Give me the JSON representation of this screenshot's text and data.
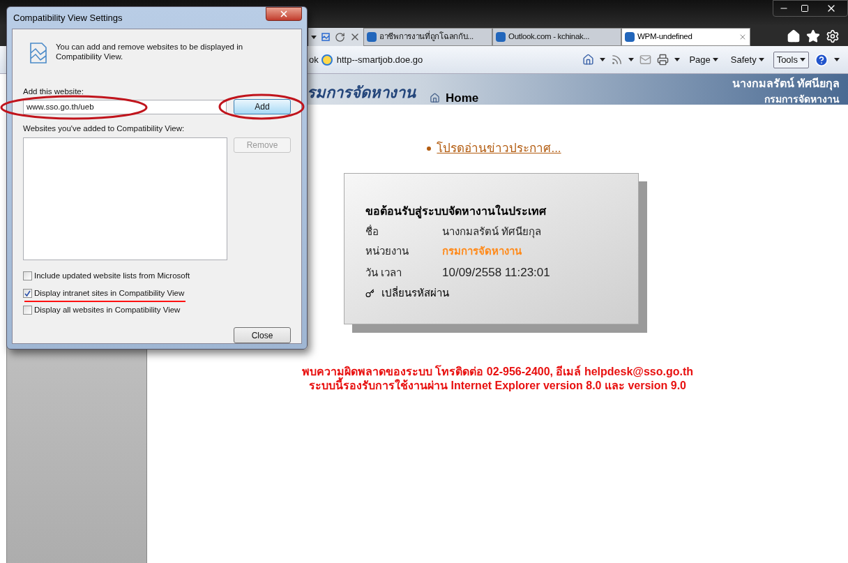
{
  "browser": {
    "tabs": [
      {
        "label": "อาชีพการงานที่ถูกโฉลกกับ...",
        "selected": false
      },
      {
        "label": "Outlook.com - kchinak...",
        "selected": false
      },
      {
        "label": "WPM-undefined",
        "selected": true
      }
    ],
    "address": {
      "prefix": "ok",
      "value": "http--smartjob.doe.go"
    },
    "command_bar": [
      {
        "label": "Page",
        "selected": false
      },
      {
        "label": "Safety",
        "selected": false
      },
      {
        "label": "Tools",
        "selected": true
      }
    ]
  },
  "page": {
    "org_title": "รมการจัดหางาน",
    "home": "Home",
    "user_name": "นางกมลรัตน์ ทัศนียกุล",
    "user_org": "กรมการจัดหางาน",
    "notice_link": "โปรดอ่านข่าวประกาศ...",
    "welcome": {
      "title": "ขอต้อนรับสู่ระบบจัดหางานในประเทศ",
      "rows": [
        {
          "label": "ชื่อ",
          "value": "นางกมลรัตน์ ทัศนียกุล",
          "kind": "plain"
        },
        {
          "label": "หน่วยงาน",
          "value": "กรมการจัดหางาน",
          "kind": "accent"
        },
        {
          "label": "วัน เวลา",
          "value": "10/09/2558 11:23:01",
          "kind": "large"
        }
      ],
      "change_password": "เปลี่ยนรหัสผ่าน"
    },
    "error_lines": [
      "พบความผิดพลาดของระบบ โทรติดต่อ 02-956-2400, อีเมล์ helpdesk@sso.go.th",
      "ระบบนี้รองรับการใช้งานผ่าน Internet Explorer version 8.0 และ version 9.0"
    ]
  },
  "dialog": {
    "title": "Compatibility View Settings",
    "intro": "You can add and remove websites to be displayed in Compatibility View.",
    "add_label": "Add this website:",
    "website_value": "www.sso.go.th/ueb",
    "add_button": "Add",
    "list_label": "Websites you've added to Compatibility View:",
    "remove_button": {
      "label": "Remove",
      "disabled": true
    },
    "options": [
      {
        "label": "Include updated website lists from Microsoft",
        "checked": false
      },
      {
        "label": "Display intranet sites in Compatibility View",
        "checked": true
      },
      {
        "label": "Display all websites in Compatibility View",
        "checked": false
      }
    ],
    "close_button": "Close"
  }
}
